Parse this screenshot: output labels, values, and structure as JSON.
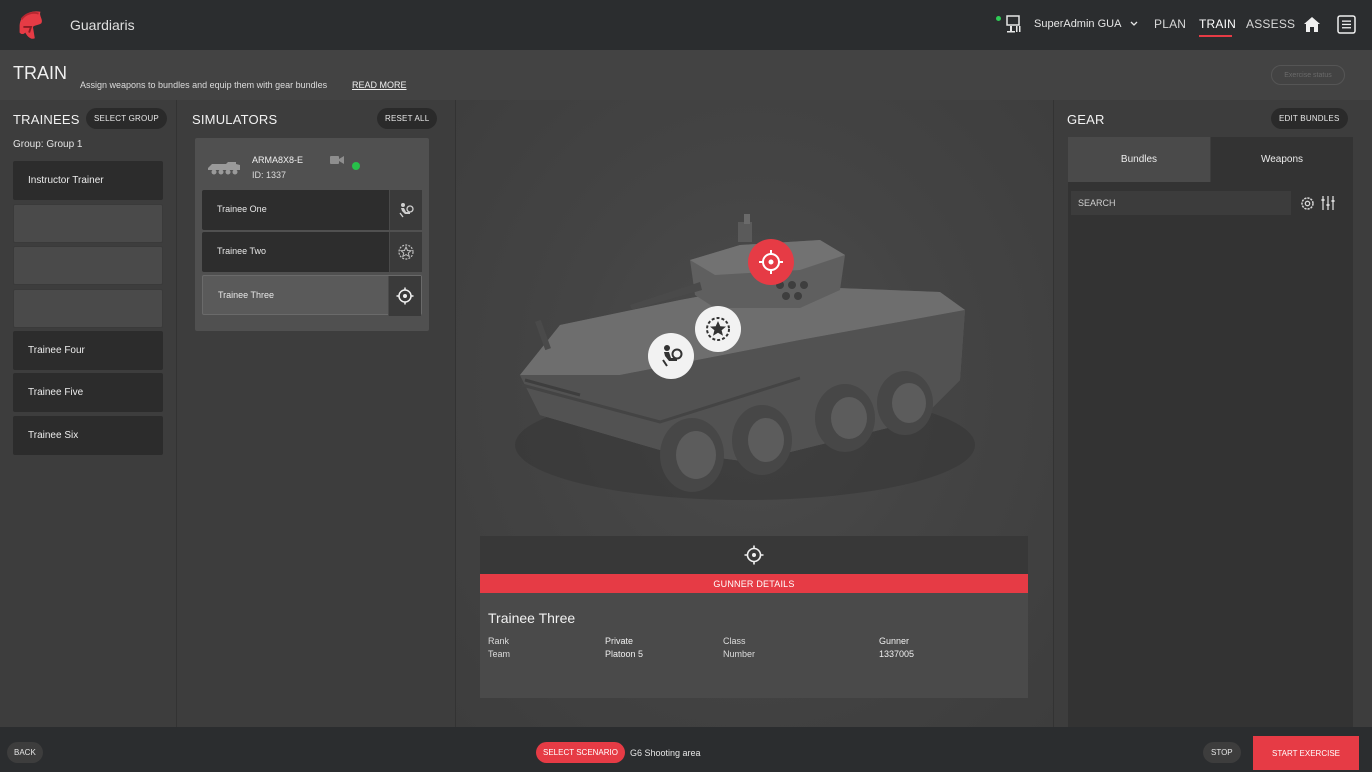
{
  "topbar": {
    "app_title": "Guardiaris",
    "user_name": "SuperAdmin GUA",
    "nav": [
      "PLAN",
      "TRAIN",
      "ASSESS"
    ],
    "active_nav": "TRAIN"
  },
  "header": {
    "title": "TRAIN",
    "description": "Assign weapons to bundles and equip them with gear bundles",
    "read_more": "READ MORE",
    "exercise_status": "Exercise status"
  },
  "trainees": {
    "title": "TRAINEES",
    "select_group": "SELECT GROUP",
    "group_label": "Group: Group 1",
    "slots": [
      "Instructor Trainer",
      "",
      "",
      "",
      "Trainee Four",
      "Trainee Five",
      "Trainee Six"
    ]
  },
  "simulators": {
    "title": "SIMULATORS",
    "reset_all": "RESET ALL",
    "card": {
      "name": "ARMA8X8-E",
      "id": "ID: 1337",
      "status_color": "#27c04a",
      "seats": [
        {
          "label": "Trainee One",
          "icon": "driver-icon"
        },
        {
          "label": "Trainee Two",
          "icon": "commander-badge-icon"
        },
        {
          "label": "Trainee Three",
          "icon": "gunner-crosshair-icon",
          "selected": true
        }
      ]
    }
  },
  "details": {
    "bar_label": "GUNNER DETAILS",
    "name": "Trainee Three",
    "rank_label": "Rank",
    "rank_value": "Private",
    "class_label": "Class",
    "class_value": "Gunner",
    "team_label": "Team",
    "team_value": "Platoon 5",
    "number_label": "Number",
    "number_value": "1337005"
  },
  "gear": {
    "title": "GEAR",
    "edit_bundles": "EDIT BUNDLES",
    "tabs": [
      "Bundles",
      "Weapons"
    ],
    "active_tab": "Bundles",
    "search_placeholder": "SEARCH"
  },
  "bottombar": {
    "back": "BACK",
    "select_scenario": "SELECT SCENARIO",
    "scenario_name": "G6 Shooting area",
    "stop": "STOP",
    "start_exercise": "START EXERCISE"
  },
  "colors": {
    "accent": "#e63b45",
    "topbar_bg": "#2b2d2f",
    "online": "#2ecc55"
  }
}
